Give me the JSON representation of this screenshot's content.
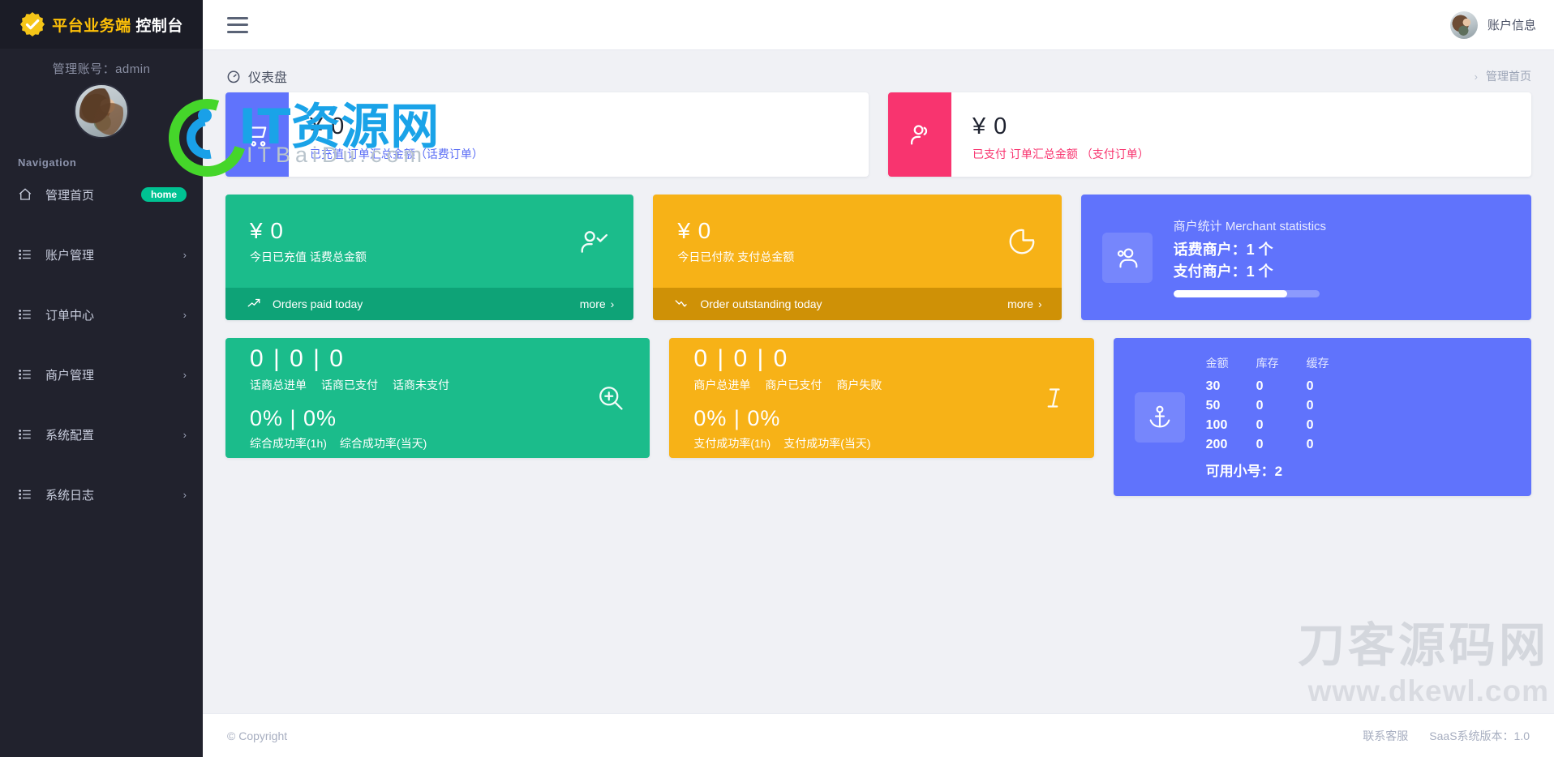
{
  "brand": {
    "title_accent": "平台业务端",
    "title_rest": " 控制台",
    "logo_icon": "check-badge-icon",
    "account_label": "管理账号：admin",
    "avatar_icon": "user-avatar"
  },
  "sidebar": {
    "nav_header": "Navigation",
    "items": [
      {
        "label": "管理首页",
        "icon": "home-icon",
        "badge": "home",
        "chevron": ""
      },
      {
        "label": "账户管理",
        "icon": "list-icon",
        "badge": "",
        "chevron": "›"
      },
      {
        "label": "订单中心",
        "icon": "list-icon",
        "badge": "",
        "chevron": "›"
      },
      {
        "label": "商户管理",
        "icon": "list-icon",
        "badge": "",
        "chevron": "›"
      },
      {
        "label": "系统配置",
        "icon": "list-icon",
        "badge": "",
        "chevron": "›"
      },
      {
        "label": "系统日志",
        "icon": "list-icon",
        "badge": "",
        "chevron": "›"
      }
    ]
  },
  "topbar": {
    "menu_icon": "hamburger-icon",
    "account_label": "账户信息",
    "avatar_icon": "user-avatar"
  },
  "page": {
    "title": "仪表盘",
    "title_icon": "dashboard-icon",
    "breadcrumb_sep": "›",
    "breadcrumb_current": "管理首页"
  },
  "cards": {
    "recharge_total": {
      "icon": "shopping-cart-icon",
      "amount": "¥ 0",
      "desc": "已充值 订单汇总金额（话费订单）",
      "color": "#6073fc"
    },
    "paid_total": {
      "icon": "users-icon",
      "amount": "¥ 0",
      "desc": "已支付 订单汇总金额 （支付订单）",
      "color": "#f8346f"
    },
    "today_recharge": {
      "icon": "user-check-icon",
      "amount": "¥ 0",
      "desc": "今日已充值 话费总金额",
      "foot_icon": "trend-up-icon",
      "foot_label": "Orders paid today",
      "more_label": "more",
      "more_icon": "chevron-right-icon",
      "color": "#1bbc8b"
    },
    "today_paid": {
      "icon": "pie-chart-icon",
      "amount": "¥ 0",
      "desc": "今日已付款 支付总金额",
      "foot_icon": "trend-down-icon",
      "foot_label": "Order outstanding today",
      "more_label": "more",
      "more_icon": "chevron-right-icon",
      "color": "#f7b217"
    },
    "merchant_stats": {
      "icon": "people-icon",
      "title": "商户统计 Merchant statistics",
      "line1": "话费商户：1 个",
      "line2": "支付商户：1 个",
      "progress_percent": 78,
      "color": "#6073fc"
    },
    "telecom_orders": {
      "numbers": "0 | 0 | 0",
      "labels": [
        "话商总进单",
        "话商已支付",
        "话商未支付"
      ],
      "percents": "0% | 0%",
      "percent_labels": [
        "综合成功率(1h)",
        "综合成功率(当天)"
      ],
      "icon": "zoom-in-icon",
      "color": "#1bbc8b"
    },
    "merchant_orders": {
      "numbers": "0 | 0 | 0",
      "labels": [
        "商户总进单",
        "商户已支付",
        "商户失败"
      ],
      "percents": "0% | 0%",
      "percent_labels": [
        "支付成功率(1h)",
        "支付成功率(当天)"
      ],
      "icon": "text-cursor-icon",
      "color": "#f7b217"
    },
    "stock_table": {
      "icon": "anchor-icon",
      "headers": [
        "金额",
        "库存",
        "缓存"
      ],
      "rows": [
        [
          "30",
          "0",
          "0"
        ],
        [
          "50",
          "0",
          "0"
        ],
        [
          "100",
          "0",
          "0"
        ],
        [
          "200",
          "0",
          "0"
        ]
      ],
      "available_label": "可用小号：2",
      "color": "#6073fc"
    }
  },
  "footer": {
    "copyright": "© Copyright",
    "support_label": "联系客服",
    "version_label": "SaaS系统版本：1.0"
  },
  "watermarks": {
    "top_text": "IT资源网",
    "top_sub": "ITBaiDu.com",
    "bottom_text": "刀客源码网",
    "bottom_url": "www.dkewl.com"
  }
}
